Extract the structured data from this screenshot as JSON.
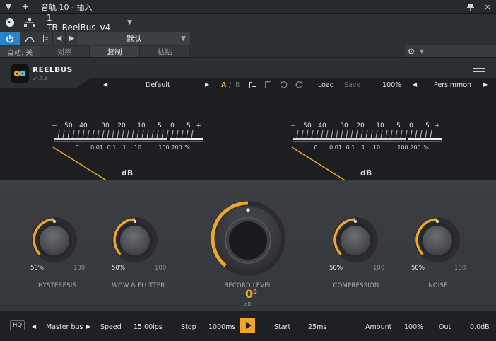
{
  "host": {
    "window_title": "音轨 10 - 插入",
    "track_name": "1 - TB_ReelBus_v4",
    "preset_name": "默认",
    "auto_label": "自动: 关",
    "compare_label": "对照",
    "copy_label": "复制",
    "paste_label": "粘贴"
  },
  "plugin": {
    "brand": "REELBUS",
    "version": "v4.7.3",
    "preset": "Default",
    "ab_a": "A",
    "ab_sep": "/",
    "ab_b": "B",
    "load_label": "Load",
    "save_label": "Save",
    "zoom": "100%",
    "theme": "Persimmon",
    "accent_color": "#f0a52a"
  },
  "meters": {
    "db_label": "dB",
    "top_scale": [
      "−",
      "50",
      "40",
      "30",
      "20",
      "10",
      "5",
      "0",
      "5",
      "+"
    ],
    "bottom_scale": [
      "0",
      "0.01",
      "0.1",
      "1",
      "10",
      "100",
      "200",
      "%"
    ]
  },
  "knobs": {
    "hysteresis": {
      "label": "HYSTERESIS",
      "value": "50%",
      "max": "100",
      "level": 0.5
    },
    "wow_flutter": {
      "label": "WOW & FLUTTER",
      "value": "50%",
      "max": "100",
      "level": 0.5
    },
    "record_level": {
      "label": "RECORD LEVEL",
      "value": "0",
      "unit": "dB",
      "suffix": "0"
    },
    "compression": {
      "label": "COMPRESSION",
      "value": "50%",
      "max": "100",
      "level": 0.5
    },
    "noise": {
      "label": "NOISE",
      "value": "50%",
      "max": "100",
      "level": 0.5
    }
  },
  "bottom": {
    "hq": "HQ",
    "bus": "Master bus",
    "speed_label": "Speed",
    "speed_value": "15.00ips",
    "stop_label": "Stop",
    "stop_value": "1000ms",
    "start_label": "Start",
    "start_value": "25ms",
    "amount_label": "Amount",
    "amount_value": "100%",
    "out_label": "Out",
    "out_value": "0.0dB"
  }
}
